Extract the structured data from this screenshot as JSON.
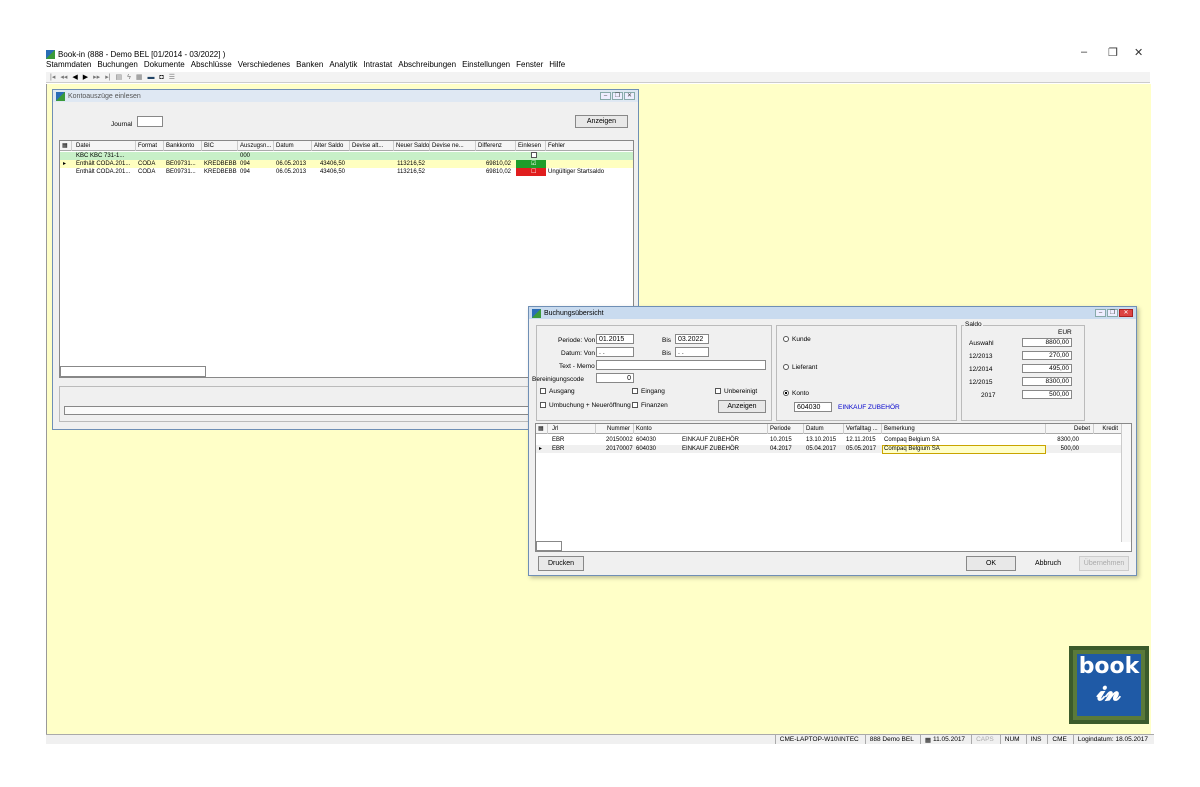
{
  "app": {
    "title": "Book-in (888 - Demo BEL [01/2014 - 03/2022] )",
    "menu": [
      "Stammdaten",
      "Buchungen",
      "Dokumente",
      "Abschlüsse",
      "Verschiedenes",
      "Banken",
      "Analytik",
      "Intrastat",
      "Abschreibungen",
      "Einstellungen",
      "Fenster",
      "Hilfe"
    ]
  },
  "window_controls": {
    "minimize": "–",
    "restore": "❐",
    "close": "✕"
  },
  "kontoauszuege": {
    "title": "Kontoauszüge einlesen",
    "journal_label": "Journal",
    "journal_value": "",
    "anzeigen_label": "Anzeigen",
    "columns": [
      "Datei",
      "Format",
      "Bankkonto",
      "BIC",
      "Auszugsn...",
      "Datum",
      "Alter Saldo",
      "Devise alt...",
      "Neuer Saldo",
      "Devise ne...",
      "Differenz",
      "Einlesen",
      "Fehler"
    ],
    "rows": [
      {
        "datei": "KBC  KBC 731-1...",
        "format": "",
        "bankkonto": "",
        "bic": "",
        "auszug": "000",
        "datum": "",
        "alter_saldo": "",
        "neuer_saldo": "",
        "differenz": "",
        "fehler": ""
      },
      {
        "datei": "Enthält CODA.201...",
        "format": "CODA",
        "bankkonto": "BE09731...",
        "bic": "KREDBEBB",
        "auszug": "094",
        "datum": "06.05.2013",
        "alter_saldo": "43406,50",
        "neuer_saldo": "113216,52",
        "differenz": "69810,02",
        "fehler": ""
      },
      {
        "datei": "Enthält CODA.201...",
        "format": "CODA",
        "bankkonto": "BE09731...",
        "bic": "KREDBEBB",
        "auszug": "094",
        "datum": "06.05.2013",
        "alter_saldo": "43406,50",
        "neuer_saldo": "113216,52",
        "differenz": "69810,02",
        "fehler": "Ungültiger Startsaldo"
      }
    ]
  },
  "buchung": {
    "title": "Buchungsübersicht",
    "periode_von_label": "Periode: Von",
    "periode_von": "01.2015",
    "bis_label": "Bis",
    "periode_bis": "03.2022",
    "datum_von_label": "Datum: Von",
    "datum_von": ". .",
    "datum_bis": ". .",
    "text_memo_label": "Text - Memo",
    "bereinigungscode_label": "Bereinigungscode",
    "bereinigungscode": "0",
    "ausgang": "Ausgang",
    "eingang": "Eingang",
    "unbereinigt": "Unbereinigt",
    "umbuchung": "Umbuchung + Neueröffnung",
    "finanzen": "Finanzen",
    "anzeigen": "Anzeigen",
    "kunde": "Kunde",
    "lieferant": "Lieferant",
    "konto": "Konto",
    "konto_nr": "604030",
    "konto_name": "EINKAUF ZUBEHÖR",
    "saldo_label": "Saldo",
    "saldo_currency": "EUR",
    "saldo": [
      {
        "label": "Auswahl",
        "value": "8800,00"
      },
      {
        "label": "12/2013",
        "value": "270,00"
      },
      {
        "label": "12/2014",
        "value": "495,00"
      },
      {
        "label": "12/2015",
        "value": "8300,00"
      },
      {
        "label": "2017",
        "value": "500,00"
      }
    ],
    "columns": [
      "Jrl",
      "Nummer",
      "Konto",
      "Periode",
      "Datum",
      "Verfalltag ...",
      "Bemerkung",
      "Debet",
      "Kredit"
    ],
    "rows": [
      {
        "jrl": "EBR",
        "nummer": "20150002",
        "konto": "604030",
        "konto_name": "EINKAUF ZUBEHÖR",
        "periode": "10.2015",
        "datum": "13.10.2015",
        "verfall": "12.11.2015",
        "bemerkung": "Compaq Belgium SA",
        "debet": "8300,00",
        "kredit": ""
      },
      {
        "jrl": "EBR",
        "nummer": "20170007",
        "konto": "604030",
        "konto_name": "EINKAUF ZUBEHÖR",
        "periode": "04.2017",
        "datum": "05.04.2017",
        "verfall": "05.05.2017",
        "bemerkung": "Compaq Belgium SA",
        "debet": "500,00",
        "kredit": ""
      }
    ],
    "drucken": "Drucken",
    "ok": "OK",
    "abbruch": "Abbruch",
    "uebernehmen": "Übernehmen"
  },
  "status": {
    "computer": "CME-LAPTOP-W10\\INTEC",
    "firma": "888 Demo BEL",
    "datum": "11.05.2017",
    "caps": "CAPS",
    "num": "NUM",
    "ins": "INS",
    "user": "CME",
    "logindatum": "Logindatum: 18.05.2017"
  },
  "logo_text": "book",
  "colors": {
    "workspace": "#ffffc8",
    "green_ok": "#1e9e2a",
    "red_err": "#e01e1e",
    "row_green": "#c8f0c8",
    "row_yellow": "#ffffc0",
    "link_blue": "#0000cc"
  }
}
